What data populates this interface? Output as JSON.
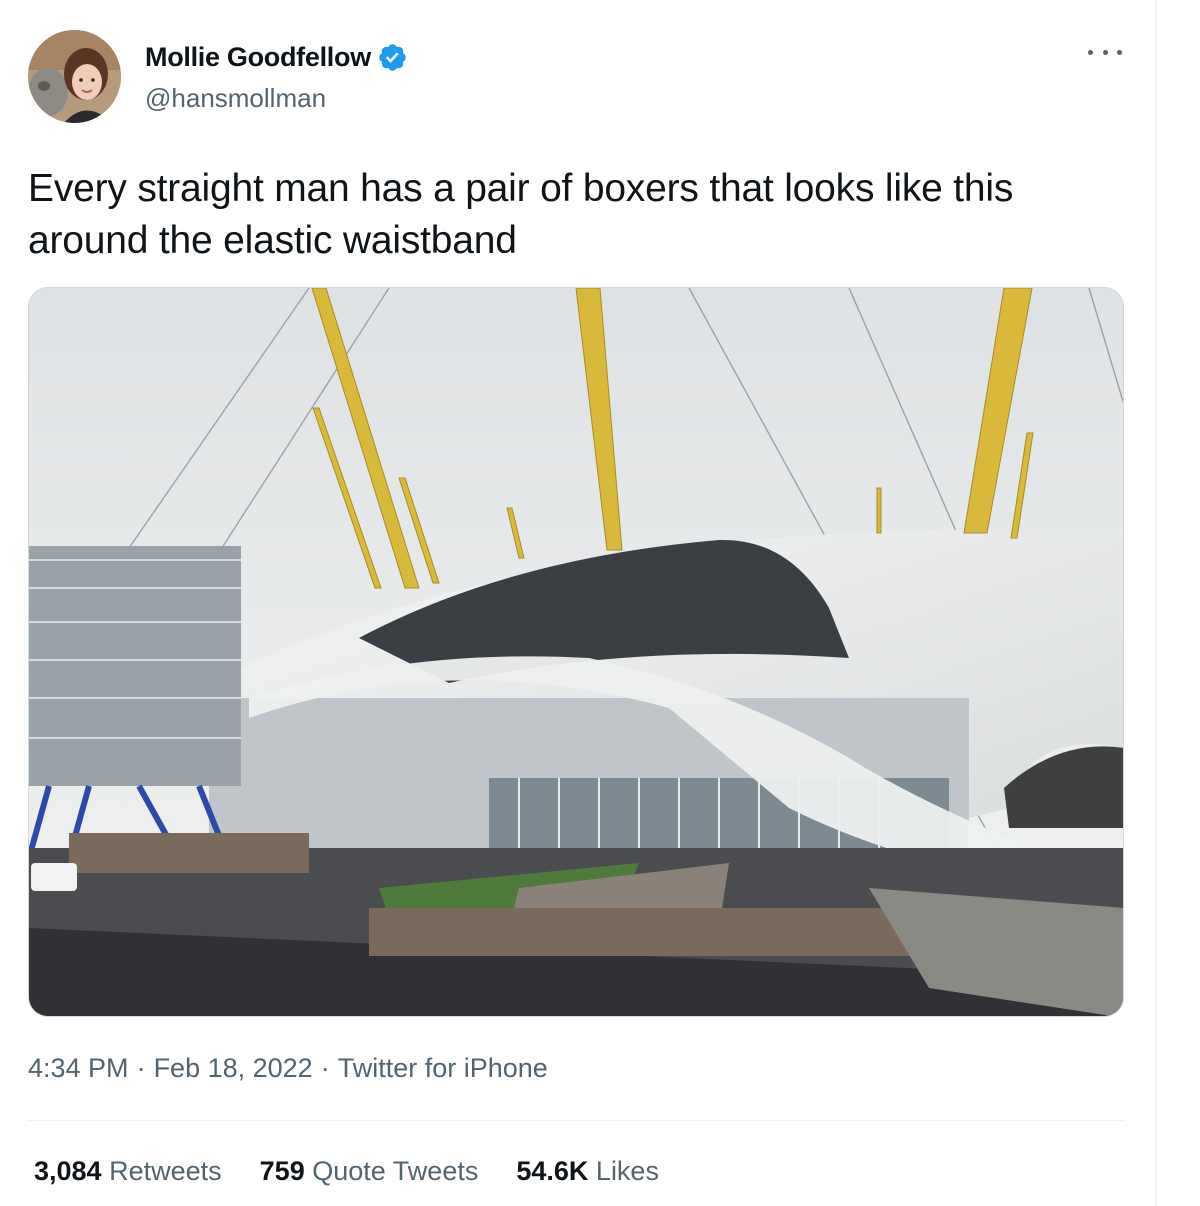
{
  "author": {
    "display_name": "Mollie Goodfellow",
    "handle": "@hansmollman",
    "verified": true,
    "avatar_icon": "profile-photo"
  },
  "tweet": {
    "text": "Every straight man has a pair of boxers that looks like this around the elastic waistband",
    "media_description": "Photo"
  },
  "meta": {
    "time": "4:34 PM",
    "date": "Feb 18, 2022",
    "source": "Twitter for iPhone",
    "separator": "·"
  },
  "stats": {
    "retweets": {
      "count": "3,084",
      "label": "Retweets"
    },
    "quotes": {
      "count": "759",
      "label": "Quote Tweets"
    },
    "likes": {
      "count": "54.6K",
      "label": "Likes"
    }
  },
  "colors": {
    "text_primary": "#0f1419",
    "text_secondary": "#536471",
    "verified_blue": "#1d9bf0",
    "divider": "#eff3f4",
    "mast_yellow": "#d8b93a"
  },
  "icons": {
    "verified": "verified-badge-icon",
    "more": "more-horizontal-icon"
  }
}
